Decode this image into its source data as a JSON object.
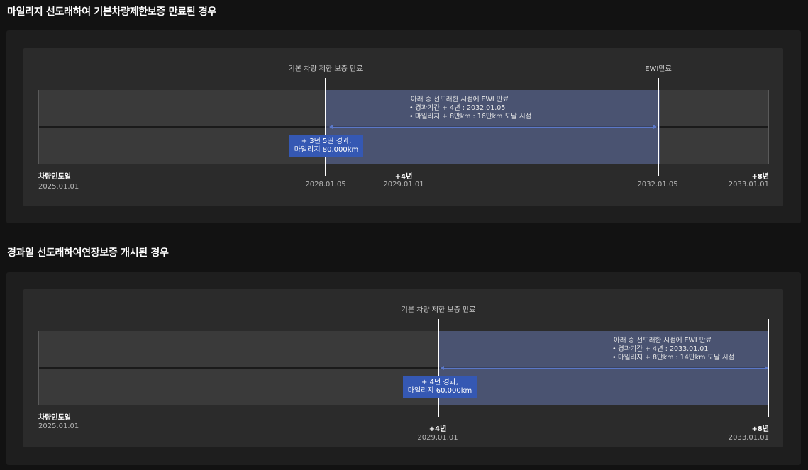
{
  "section1": {
    "title": "마일리지 선도래하여 기본차량제한보증 만료된 경우",
    "top_label_1": "기본 차량 제한 보증 만료",
    "top_label_2": "EWI만료",
    "note_title": "아래 중 선도래한 시점에 EWI 만료",
    "note_items": [
      "경과기간 + 4년  : 2032.01.05",
      "마일리지 + 8만km : 16만km 도달 시점"
    ],
    "box_label": "+ 3년 5일 경과,\n마일리지 80,000km",
    "ticks": [
      {
        "title": "차량인도일",
        "date": "2025.01.01"
      },
      {
        "title": "",
        "date": "2028.01.05"
      },
      {
        "title": "+4년",
        "date": "2029.01.01"
      },
      {
        "title": "",
        "date": "2032.01.05"
      },
      {
        "title": "+8년",
        "date": "2033.01.01"
      }
    ]
  },
  "section2": {
    "title": "경과일 선도래하여연장보증 개시된 경우",
    "top_label_1": "기본 차량 제한 보증 만료",
    "note_title": "아래 중 선도래한 시점에 EWI 만료",
    "note_items": [
      "경과기간 + 4년  : 2033.01.01",
      "마일리지 + 8만km : 14만km 도달 시점"
    ],
    "box_label": "+ 4년 경과,\n마일리지 60,000km",
    "ticks": [
      {
        "title": "차량인도일",
        "date": "2025.01.01"
      },
      {
        "title": "+4년",
        "date": "2029.01.01"
      },
      {
        "title": "+8년",
        "date": "2033.01.01"
      }
    ]
  },
  "colors": {
    "band": "#58689e",
    "arrow": "#5b78c8",
    "box": "#3558b3",
    "track": "#3a3a3a"
  }
}
